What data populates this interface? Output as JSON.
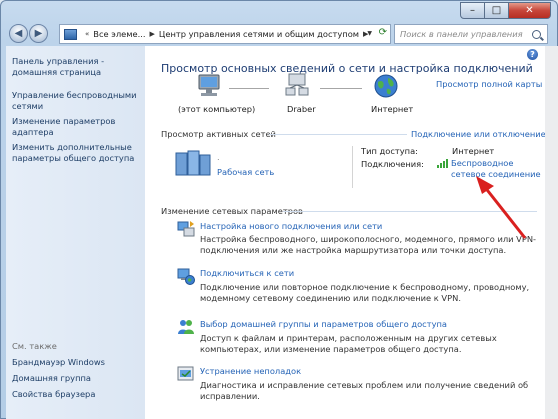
{
  "nav": {
    "breadcrumb": [
      "Все элеме...",
      "Центр управления сетями и общим доступом"
    ],
    "search_placeholder": "Поиск в панели управления"
  },
  "left": {
    "links": [
      "Панель управления - домашняя страница",
      "Управление беспроводными сетями",
      "Изменение параметров адаптера",
      "Изменить дополнительные параметры общего доступа"
    ],
    "see_also_heading": "См. также",
    "see_also": [
      "Брандмауэр Windows",
      "Домашняя группа",
      "Свойства браузера"
    ]
  },
  "main": {
    "title": "Просмотр основных сведений о сети и настройка подключений",
    "full_map_link": "Просмотр полной карты",
    "map": {
      "computer_label": "(этот компьютер)",
      "network_label": "Draber",
      "internet_label": "Интернет"
    },
    "active_networks": {
      "heading": "Просмотр активных сетей",
      "connect_link": "Подключение или отключение",
      "network_name": ".",
      "network_type": "Рабочая сеть",
      "access_type_label": "Тип доступа:",
      "access_type_value": "Интернет",
      "connections_label": "Подключения:",
      "connection_value": "Беспроводное сетевое соединение"
    },
    "change_settings": {
      "heading": "Изменение сетевых параметров",
      "tasks": [
        {
          "title": "Настройка нового подключения или сети",
          "desc": "Настройка беспроводного, широкополосного, модемного, прямого или VPN-подключения или же настройка маршрутизатора или точки доступа.",
          "icon": "network-setup-icon"
        },
        {
          "title": "Подключиться к сети",
          "desc": "Подключение или повторное подключение к беспроводному, проводному, модемному сетевому соединению или подключение к VPN.",
          "icon": "connect-network-icon"
        },
        {
          "title": "Выбор домашней группы и параметров общего доступа",
          "desc": "Доступ к файлам и принтерам, расположенным на других сетевых компьютерах, или изменение параметров общего доступа.",
          "icon": "homegroup-icon"
        },
        {
          "title": "Устранение неполадок",
          "desc": "Диагностика и исправление сетевых проблем или получение сведений об исправлении.",
          "icon": "troubleshoot-icon"
        }
      ]
    }
  },
  "colors": {
    "link": "#2463b6",
    "heading": "#1e3d73",
    "annotation_arrow": "#d9201f"
  }
}
